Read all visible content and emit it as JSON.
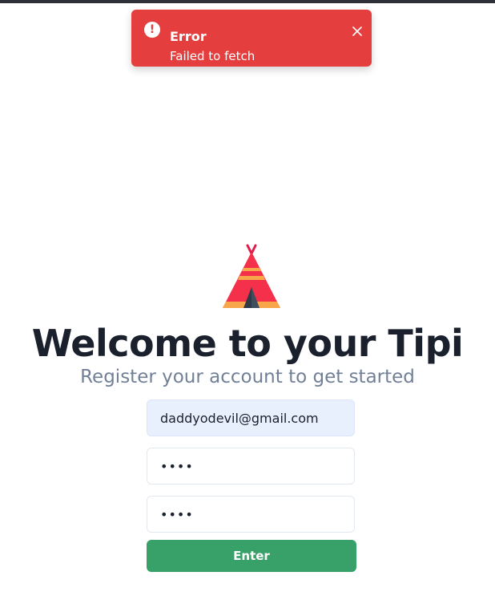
{
  "toast": {
    "title": "Error",
    "message": "Failed to fetch",
    "icon": "alert-circle-icon",
    "close_icon": "close-icon",
    "color": "#e53e3e"
  },
  "logo": {
    "icon": "tipi-tent-logo"
  },
  "heading": {
    "title": "Welcome to your Tipi",
    "subtitle": "Register your account to get started"
  },
  "form": {
    "email_value": "daddyodevil@gmail.com",
    "password_value": "••••",
    "password_confirm_value": "••••",
    "submit_label": "Enter",
    "submit_color": "#38a169"
  }
}
